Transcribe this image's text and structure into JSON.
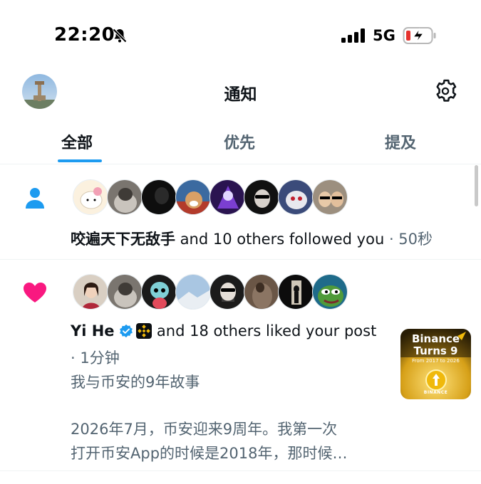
{
  "status_bar": {
    "time": "22:20",
    "network": "5G",
    "icons": [
      "bell-muted-icon",
      "signal-bars-icon",
      "battery-charging-icon"
    ]
  },
  "header": {
    "title": "通知",
    "settings_icon": "gear-icon",
    "avatar_icon": "profile-avatar"
  },
  "tabs": [
    {
      "label": "全部",
      "active": true
    },
    {
      "label": "优先",
      "active": false
    },
    {
      "label": "提及",
      "active": false
    }
  ],
  "notifications": [
    {
      "type": "follow",
      "icon": "person-icon",
      "actor": "咬遍天下无敌手",
      "text": " and 10 others followed you",
      "time": " · 50秒",
      "avatars": [
        "hello-kitty",
        "cat",
        "dark",
        "dog",
        "purple-hero",
        "sunglasses-man",
        "red-cartoon",
        "duo-sunglasses"
      ]
    },
    {
      "type": "like",
      "icon": "heart-icon",
      "actor": "Yi He",
      "text": " and 18 others liked your post",
      "time": "· 1分钟",
      "post_title": "我与币安的9年故事",
      "post_line1": "2026年7月，币安迎来9周年。我第一次",
      "post_line2": "打开币安App的时候是2018年，那时候…",
      "avatars": [
        "woman",
        "cat",
        "astronaut-toy",
        "sky",
        "man-beard",
        "desert",
        "dark-figure",
        "pepe"
      ],
      "thumbnail": {
        "line1": "Binance",
        "line2": "Turns 9",
        "subtitle": "From 2017 to 2026",
        "brand": "BINANCE"
      }
    }
  ],
  "colors": {
    "accent": "#1d9bf0",
    "like": "#f91880",
    "text": "#0f1419",
    "muted": "#536471",
    "binance_gold": "#f0b90b"
  }
}
